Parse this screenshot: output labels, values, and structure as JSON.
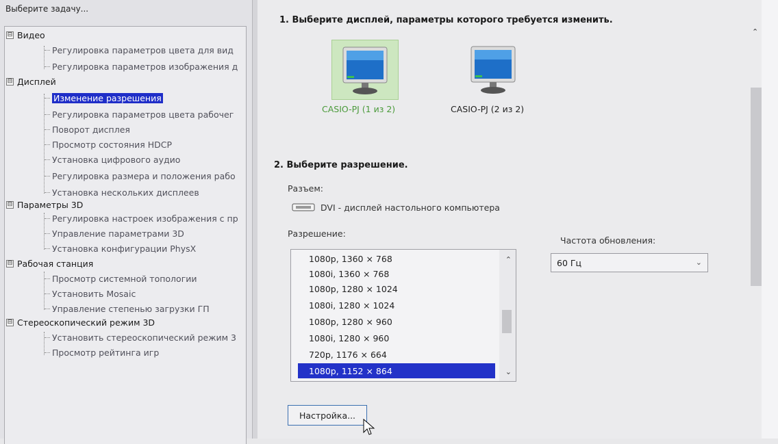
{
  "left": {
    "header": "Выберите задачу...",
    "tree": [
      {
        "label": "Видео",
        "toggle": "⊟",
        "children": [
          "Регулировка параметров цвета для вид",
          "Регулировка параметров изображения д"
        ]
      },
      {
        "label": "Дисплей",
        "toggle": "⊟",
        "children": [
          "Изменение разрешения",
          "Регулировка параметров цвета рабочег",
          "Поворот дисплея",
          "Просмотр состояния HDCP",
          "Установка цифрового аудио",
          "Регулировка размера и положения рабо",
          "Установка нескольких дисплеев"
        ]
      },
      {
        "label": "Параметры 3D",
        "toggle": "⊟",
        "children": [
          "Регулировка настроек изображения с пр",
          "Управление параметрами 3D",
          "Установка конфигурации PhysX"
        ]
      },
      {
        "label": "Рабочая станция",
        "toggle": "⊟",
        "children": [
          "Просмотр системной топологии",
          "Установить Mosaic",
          "Управление степенью загрузки ГП"
        ]
      },
      {
        "label": "Стереоскопический режим 3D",
        "toggle": "⊟",
        "children": [
          "Установить стереоскопический режим 3",
          "Просмотр рейтинга игр"
        ]
      }
    ],
    "selected": "Изменение разрешения"
  },
  "main": {
    "step1_title": "1. Выберите дисплей, параметры которого требуется изменить.",
    "displays": [
      {
        "label": "CASIO-PJ (1 из 2)",
        "selected": true
      },
      {
        "label": "CASIO-PJ (2 из 2)",
        "selected": false
      }
    ],
    "step2_title": "2. Выберите разрешение.",
    "connector_label": "Разъем:",
    "connector_value": "DVI - дисплей настольного компьютера",
    "resolution_label": "Разрешение:",
    "resolutions": [
      "1080p, 1360 × 768",
      "1080i, 1360 × 768",
      "1080p, 1280 × 1024",
      "1080i, 1280 × 1024",
      "1080p, 1280 × 960",
      "1080i, 1280 × 960",
      "720p, 1176 × 664",
      "1080p, 1152 × 864"
    ],
    "selected_resolution": "1080p, 1152 × 864",
    "refresh_label": "Частота обновления:",
    "refresh_value": "60 Гц",
    "setup_button": "Настройка..."
  },
  "colors": {
    "selection": "#2332c8",
    "selected_display_text": "#4a9a3a"
  }
}
